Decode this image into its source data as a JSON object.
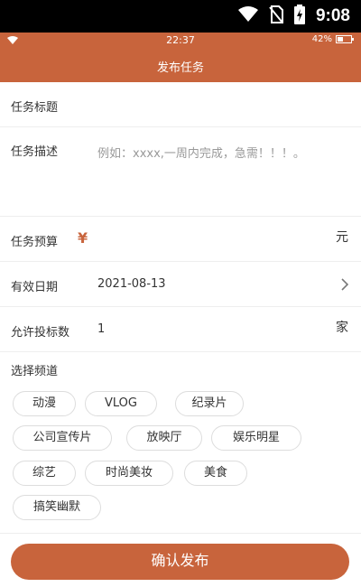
{
  "system_bar": {
    "time": "9:08"
  },
  "app_status": {
    "time": "22:37",
    "battery": "42%",
    "battery_level": 0.42
  },
  "header": {
    "title": "发布任务"
  },
  "form": {
    "title_label": "任务标题",
    "title_value": "",
    "description_label": "任务描述",
    "description_placeholder": "例如：xxxx,一周内完成，急需！！！。",
    "budget_label": "任务预算",
    "budget_symbol": "¥",
    "budget_value": "",
    "budget_unit": "元",
    "date_label": "有效日期",
    "date_value": "2021-08-13",
    "bidders_label": "允许投标数",
    "bidders_value": "1",
    "bidders_unit": "家"
  },
  "channels": {
    "label": "选择频道",
    "items": [
      "动漫",
      "VLOG",
      "纪录片",
      "公司宣传片",
      "放映厅",
      "娱乐明星",
      "综艺",
      "时尚美妆",
      "美食",
      "搞笑幽默"
    ]
  },
  "actions": {
    "confirm_label": "确认发布"
  },
  "colors": {
    "accent": "#c8643c",
    "border": "#eeeeee"
  }
}
